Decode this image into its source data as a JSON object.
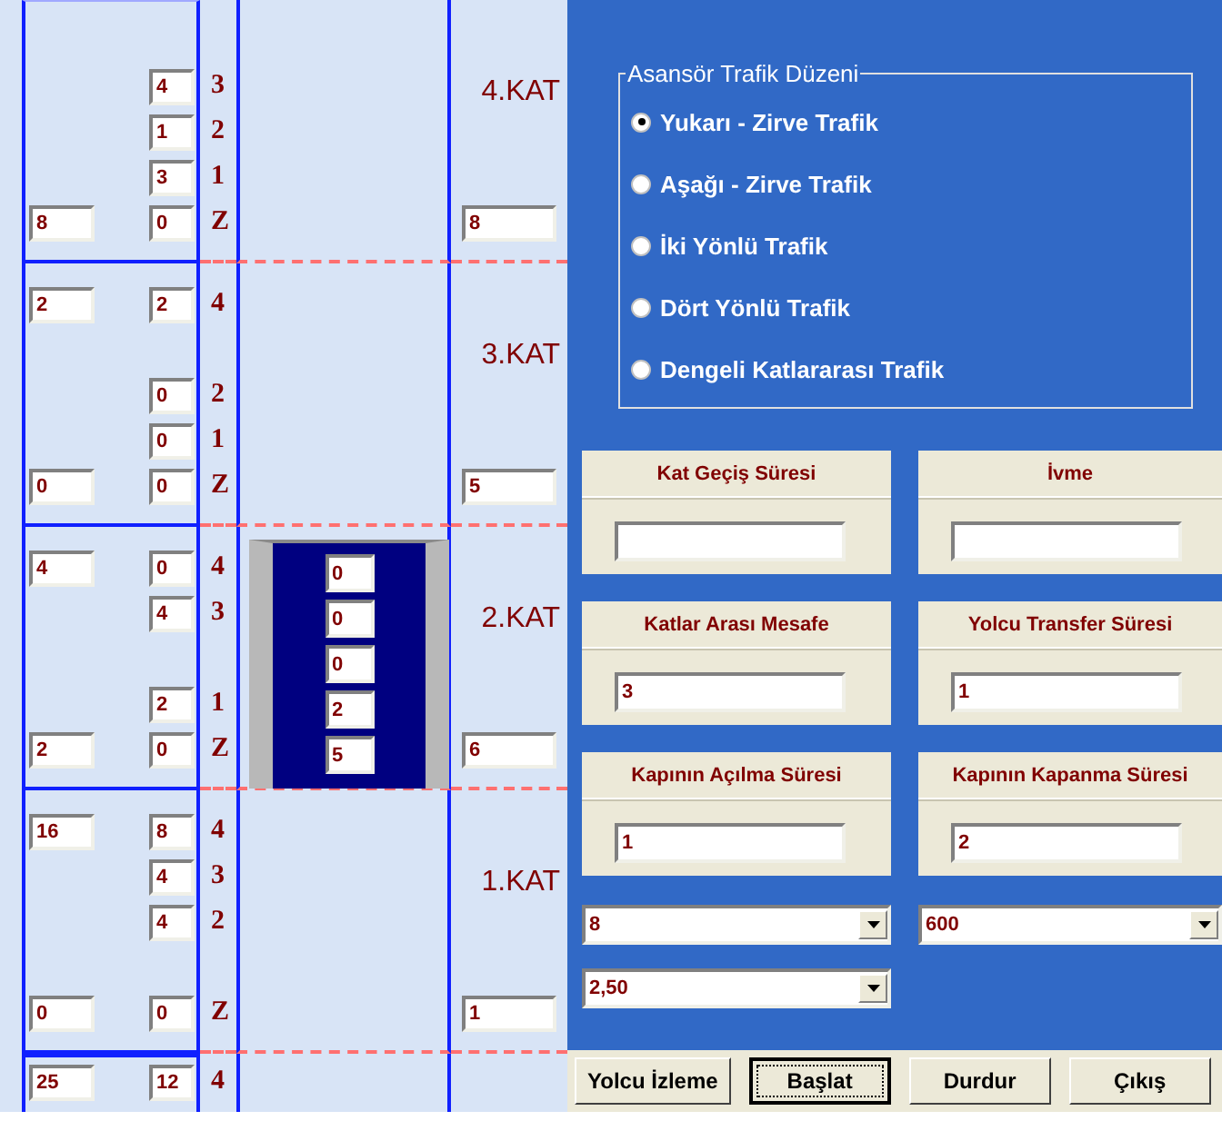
{
  "floors": [
    {
      "label": "4.KAT",
      "total": "8",
      "slots": [
        {
          "kind": "gap"
        },
        {
          "kind": "stop",
          "label": "3",
          "count": "4"
        },
        {
          "kind": "stop",
          "label": "2",
          "count": "1"
        },
        {
          "kind": "stop",
          "label": "1",
          "count": "3"
        },
        {
          "kind": "stop",
          "label": "Z",
          "waiting": "8",
          "count": "0"
        }
      ]
    },
    {
      "label": "3.KAT",
      "total": "5",
      "slots": [
        {
          "kind": "stop",
          "label": "4",
          "waiting": "2",
          "count": "2"
        },
        {
          "kind": "gap"
        },
        {
          "kind": "stop",
          "label": "2",
          "count": "0"
        },
        {
          "kind": "stop",
          "label": "1",
          "count": "0"
        },
        {
          "kind": "stop",
          "label": "Z",
          "waiting": "0",
          "count": "0"
        }
      ]
    },
    {
      "label": "2.KAT",
      "total": "6",
      "car": {
        "loads": [
          "0",
          "0",
          "0",
          "2",
          "5"
        ]
      },
      "slots": [
        {
          "kind": "stop",
          "label": "4",
          "waiting": "4",
          "count": "0"
        },
        {
          "kind": "stop",
          "label": "3",
          "count": "4"
        },
        {
          "kind": "gap"
        },
        {
          "kind": "stop",
          "label": "1",
          "count": "2"
        },
        {
          "kind": "stop",
          "label": "Z",
          "waiting": "2",
          "count": "0"
        }
      ]
    },
    {
      "label": "1.KAT",
      "total": "1",
      "slots": [
        {
          "kind": "stop",
          "label": "4",
          "waiting": "16",
          "count": "8"
        },
        {
          "kind": "stop",
          "label": "3",
          "count": "4"
        },
        {
          "kind": "stop",
          "label": "2",
          "count": "4"
        },
        {
          "kind": "gap"
        },
        {
          "kind": "stop",
          "label": "Z",
          "waiting": "0",
          "count": "0"
        }
      ]
    },
    {
      "slots": [
        {
          "kind": "stop",
          "label": "4",
          "waiting": "25",
          "count": "12"
        }
      ]
    }
  ],
  "traffic_mode": {
    "title": "Asansör Trafik Düzeni",
    "options": [
      {
        "label": "Yukarı - Zirve Trafik",
        "selected": true
      },
      {
        "label": "Aşağı - Zirve Trafik",
        "selected": false
      },
      {
        "label": "İki Yönlü Trafik",
        "selected": false
      },
      {
        "label": "Dört Yönlü Trafik",
        "selected": false
      },
      {
        "label": "Dengeli Katlararası Trafik",
        "selected": false
      }
    ]
  },
  "parameters": [
    {
      "label": "Kat Geçiş Süresi"
    },
    {
      "label": "İvme"
    },
    {
      "label": "Katlar Arası Mesafe",
      "value": "3"
    },
    {
      "label": "Yolcu Transfer Süresi",
      "value": "1"
    },
    {
      "label": "Kapının Açılma Süresi",
      "value": "1"
    },
    {
      "label": "Kapının Kapanma Süresi",
      "value": "2"
    }
  ],
  "dropdowns": [
    {
      "value": "8"
    },
    {
      "value": "600"
    },
    {
      "value": "2,50"
    }
  ],
  "buttons": [
    {
      "label": "Yolcu İzleme",
      "focused": false
    },
    {
      "label": "Başlat",
      "focused": true
    },
    {
      "label": "Durdur",
      "focused": false
    },
    {
      "label": "Çıkış",
      "focused": false
    }
  ]
}
